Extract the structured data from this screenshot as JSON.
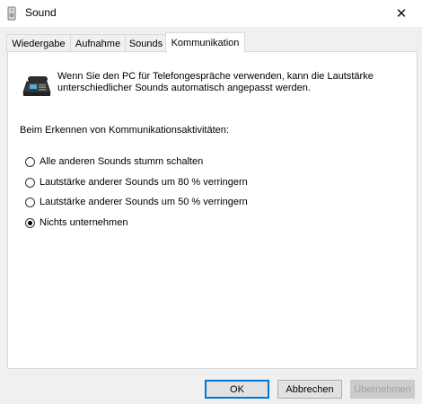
{
  "window": {
    "title": "Sound",
    "close_glyph": "✕",
    "app_icon": "speaker-icon"
  },
  "tabs": [
    {
      "label": "Wiedergabe",
      "active": false
    },
    {
      "label": "Aufnahme",
      "active": false
    },
    {
      "label": "Sounds",
      "active": false
    },
    {
      "label": "Kommunikation",
      "active": true
    }
  ],
  "main": {
    "icon": "telephone-icon",
    "info_line1": "Wenn Sie den PC für Telefongespräche verwenden, kann die Lautstärke",
    "info_line2": "unterschiedlicher Sounds automatisch angepasst werden.",
    "section_label": "Beim Erkennen von Kommunikationsaktivitäten:",
    "options": [
      {
        "label": "Alle anderen Sounds stumm schalten",
        "checked": false
      },
      {
        "label": "Lautstärke anderer Sounds um 80 % verringern",
        "checked": false
      },
      {
        "label": "Lautstärke anderer Sounds um 50 % verringern",
        "checked": false
      },
      {
        "label": "Nichts unternehmen",
        "checked": true
      }
    ]
  },
  "buttons": {
    "ok": "OK",
    "cancel": "Abbrechen",
    "apply": "Übernehmen"
  },
  "colors": {
    "accent": "#0078d7",
    "panel_bg": "#ffffff",
    "window_bg": "#f0f0f0"
  }
}
